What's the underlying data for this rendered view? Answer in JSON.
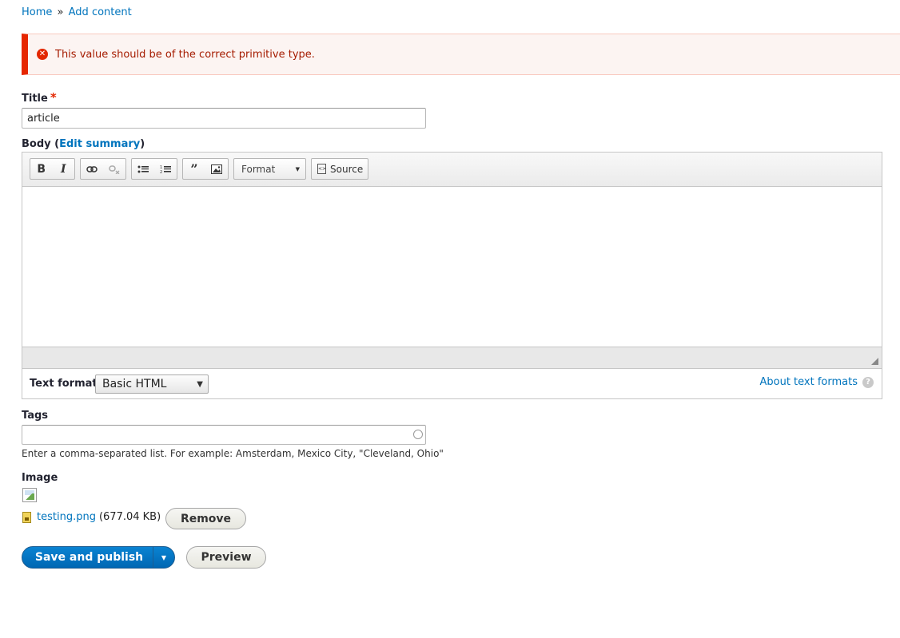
{
  "breadcrumb": {
    "home": "Home",
    "separator": "»",
    "current": "Add content"
  },
  "message": {
    "type": "error",
    "text": "This value should be of the correct primitive type.",
    "icon": "error-circle-icon",
    "color": "#e62600"
  },
  "title_field": {
    "label": "Title",
    "required_mark": "*",
    "value": "article"
  },
  "body_field": {
    "label": "Body",
    "paren_open": "(",
    "edit_summary": "Edit summary",
    "paren_close": ")",
    "toolbar": {
      "bold": "B",
      "italic": "I",
      "format_label": "Format",
      "source_label": "Source"
    },
    "text_format_label": "Text format",
    "text_format_value": "Basic HTML",
    "about_text_formats": "About text formats",
    "help_glyph": "?"
  },
  "tags_field": {
    "label": "Tags",
    "value": "",
    "description": "Enter a comma-separated list. For example: Amsterdam, Mexico City, \"Cleveland, Ohio\""
  },
  "image_field": {
    "label": "Image",
    "file_name": "testing.png",
    "file_size": "(677.04 KB)",
    "remove_label": "Remove"
  },
  "actions": {
    "save_publish": "Save and publish",
    "preview": "Preview",
    "accent": "#0074bd"
  }
}
